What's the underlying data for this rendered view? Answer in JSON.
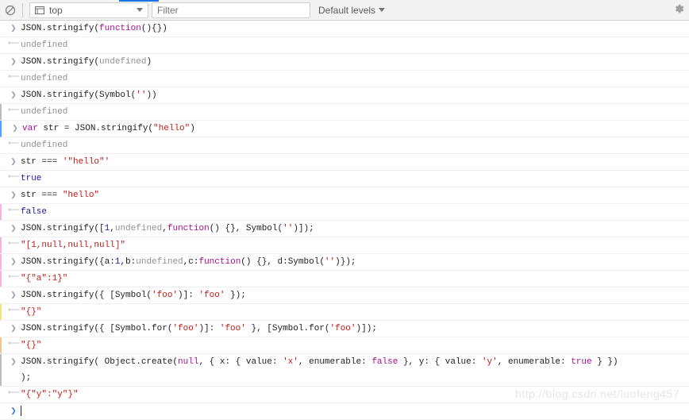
{
  "toolbar": {
    "context": "top",
    "filter_placeholder": "Filter",
    "levels_label": "Default levels"
  },
  "entries": [
    {
      "kind": "in",
      "tokens": [
        [
          "",
          "JSON.stringify("
        ],
        [
          "fn",
          "function"
        ],
        [
          "",
          "(){})"
        ]
      ],
      "leftbar": ""
    },
    {
      "kind": "out",
      "tokens": [
        [
          "undef",
          "undefined"
        ]
      ],
      "leftbar": ""
    },
    {
      "kind": "in",
      "tokens": [
        [
          "",
          "JSON.stringify("
        ],
        [
          "undef",
          "undefined"
        ],
        [
          "",
          ")"
        ]
      ],
      "leftbar": ""
    },
    {
      "kind": "out",
      "tokens": [
        [
          "undef",
          "undefined"
        ]
      ],
      "leftbar": ""
    },
    {
      "kind": "in",
      "tokens": [
        [
          "",
          "JSON.stringify(Symbol("
        ],
        [
          "str",
          "''"
        ],
        [
          "",
          "))"
        ]
      ],
      "leftbar": ""
    },
    {
      "kind": "out",
      "tokens": [
        [
          "undef",
          "undefined"
        ]
      ],
      "leftbar": "grey"
    },
    {
      "kind": "in",
      "tokens": [
        [
          "kw",
          "var"
        ],
        [
          "",
          " str = JSON.stringify("
        ],
        [
          "str",
          "\"hello\""
        ],
        [
          "",
          ")"
        ]
      ],
      "leftbar": "",
      "live": true
    },
    {
      "kind": "out",
      "tokens": [
        [
          "undef",
          "undefined"
        ]
      ],
      "leftbar": ""
    },
    {
      "kind": "in",
      "tokens": [
        [
          "",
          "str "
        ],
        [
          "eq",
          "==="
        ],
        [
          "",
          " "
        ],
        [
          "str",
          "'\"hello\"'"
        ]
      ],
      "leftbar": ""
    },
    {
      "kind": "out",
      "tokens": [
        [
          "bool-true",
          "true"
        ]
      ],
      "leftbar": ""
    },
    {
      "kind": "in",
      "tokens": [
        [
          "",
          "str "
        ],
        [
          "eq",
          "==="
        ],
        [
          "",
          " "
        ],
        [
          "str",
          "\"hello\""
        ]
      ],
      "leftbar": ""
    },
    {
      "kind": "out",
      "tokens": [
        [
          "bool-false",
          "false"
        ]
      ],
      "leftbar": "pink"
    },
    {
      "kind": "in",
      "tokens": [
        [
          "",
          "JSON.stringify(["
        ],
        [
          "num",
          "1"
        ],
        [
          "",
          ","
        ],
        [
          "undef",
          "undefined"
        ],
        [
          "",
          ","
        ],
        [
          "fn",
          "function"
        ],
        [
          "",
          "() {}, Symbol("
        ],
        [
          "str",
          "''"
        ],
        [
          "",
          ")]);"
        ]
      ],
      "leftbar": ""
    },
    {
      "kind": "out",
      "tokens": [
        [
          "result-str",
          "\"[1,null,null,null]\""
        ]
      ],
      "leftbar": "pink"
    },
    {
      "kind": "in",
      "tokens": [
        [
          "",
          "JSON.stringify({a:"
        ],
        [
          "num",
          "1"
        ],
        [
          "",
          ",b:"
        ],
        [
          "undef",
          "undefined"
        ],
        [
          "",
          ",c:"
        ],
        [
          "fn",
          "function"
        ],
        [
          "",
          "() {}, d:Symbol("
        ],
        [
          "str",
          "''"
        ],
        [
          "",
          ")});"
        ]
      ],
      "leftbar": "pink"
    },
    {
      "kind": "out",
      "tokens": [
        [
          "result-str",
          "\"{\"a\":1}\""
        ]
      ],
      "leftbar": "pink"
    },
    {
      "kind": "in",
      "tokens": [
        [
          "",
          "JSON.stringify({ [Symbol("
        ],
        [
          "str",
          "'foo'"
        ],
        [
          "",
          ")]: "
        ],
        [
          "str",
          "'foo'"
        ],
        [
          "",
          " });"
        ]
      ],
      "leftbar": ""
    },
    {
      "kind": "out",
      "tokens": [
        [
          "result-str",
          "\"{}\""
        ]
      ],
      "leftbar": "yellow"
    },
    {
      "kind": "in",
      "tokens": [
        [
          "",
          "JSON.stringify({ [Symbol.for("
        ],
        [
          "str",
          "'foo'"
        ],
        [
          "",
          ")]: "
        ],
        [
          "str",
          "'foo'"
        ],
        [
          "",
          " }, [Symbol.for("
        ],
        [
          "str",
          "'foo'"
        ],
        [
          "",
          ")]);"
        ]
      ],
      "leftbar": ""
    },
    {
      "kind": "out",
      "tokens": [
        [
          "result-str",
          "\"{}\""
        ]
      ],
      "leftbar": "peach"
    },
    {
      "kind": "in",
      "tokens": [
        [
          "",
          "JSON.stringify( Object.create("
        ],
        [
          "kw",
          "null"
        ],
        [
          "",
          ", { x: { value: "
        ],
        [
          "str",
          "'x'"
        ],
        [
          "",
          ", enumerable: "
        ],
        [
          "kw",
          "false"
        ],
        [
          "",
          " }, y: { value: "
        ],
        [
          "str",
          "'y'"
        ],
        [
          "",
          ", enumerable: "
        ],
        [
          "kw",
          "true"
        ],
        [
          "",
          " } })\n);"
        ]
      ],
      "leftbar": "grey"
    },
    {
      "kind": "out",
      "tokens": [
        [
          "result-str",
          "\"{\"y\":\"y\"}\""
        ]
      ],
      "leftbar": ""
    }
  ],
  "watermark": "http://blog.csdn.net/luofeng457"
}
